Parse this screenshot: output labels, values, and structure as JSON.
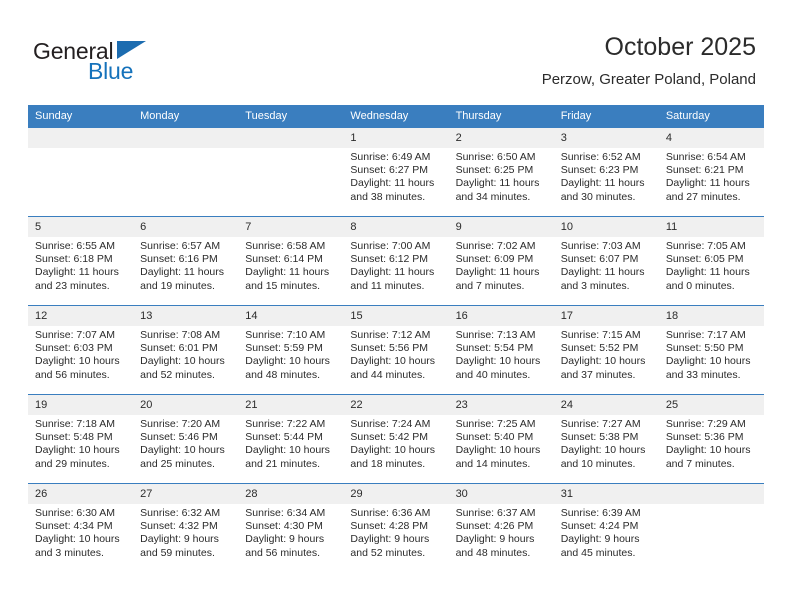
{
  "logo": {
    "word_top": "General",
    "word_bottom": "Blue",
    "triangle_color": "#1c6cb0",
    "blue_text_color": "#1572bb",
    "dark_text_color": "#231f20"
  },
  "header": {
    "title": "October 2025",
    "subtitle": "Perzow, Greater Poland, Poland"
  },
  "theme": {
    "header_blue": "#3a7ebf",
    "daynum_band": "#f0f0f0",
    "text": "#2b2b2b"
  },
  "weekday_headers": [
    "Sunday",
    "Monday",
    "Tuesday",
    "Wednesday",
    "Thursday",
    "Friday",
    "Saturday"
  ],
  "weeks": [
    [
      {
        "day": "",
        "empty": true,
        "sunrise": "",
        "sunset": "",
        "daylight_line1": "",
        "daylight_line2": ""
      },
      {
        "day": "",
        "empty": true,
        "sunrise": "",
        "sunset": "",
        "daylight_line1": "",
        "daylight_line2": ""
      },
      {
        "day": "",
        "empty": true,
        "sunrise": "",
        "sunset": "",
        "daylight_line1": "",
        "daylight_line2": ""
      },
      {
        "day": "1",
        "empty": false,
        "sunrise": "Sunrise: 6:49 AM",
        "sunset": "Sunset: 6:27 PM",
        "daylight_line1": "Daylight: 11 hours",
        "daylight_line2": "and 38 minutes."
      },
      {
        "day": "2",
        "empty": false,
        "sunrise": "Sunrise: 6:50 AM",
        "sunset": "Sunset: 6:25 PM",
        "daylight_line1": "Daylight: 11 hours",
        "daylight_line2": "and 34 minutes."
      },
      {
        "day": "3",
        "empty": false,
        "sunrise": "Sunrise: 6:52 AM",
        "sunset": "Sunset: 6:23 PM",
        "daylight_line1": "Daylight: 11 hours",
        "daylight_line2": "and 30 minutes."
      },
      {
        "day": "4",
        "empty": false,
        "sunrise": "Sunrise: 6:54 AM",
        "sunset": "Sunset: 6:21 PM",
        "daylight_line1": "Daylight: 11 hours",
        "daylight_line2": "and 27 minutes."
      }
    ],
    [
      {
        "day": "5",
        "empty": false,
        "sunrise": "Sunrise: 6:55 AM",
        "sunset": "Sunset: 6:18 PM",
        "daylight_line1": "Daylight: 11 hours",
        "daylight_line2": "and 23 minutes."
      },
      {
        "day": "6",
        "empty": false,
        "sunrise": "Sunrise: 6:57 AM",
        "sunset": "Sunset: 6:16 PM",
        "daylight_line1": "Daylight: 11 hours",
        "daylight_line2": "and 19 minutes."
      },
      {
        "day": "7",
        "empty": false,
        "sunrise": "Sunrise: 6:58 AM",
        "sunset": "Sunset: 6:14 PM",
        "daylight_line1": "Daylight: 11 hours",
        "daylight_line2": "and 15 minutes."
      },
      {
        "day": "8",
        "empty": false,
        "sunrise": "Sunrise: 7:00 AM",
        "sunset": "Sunset: 6:12 PM",
        "daylight_line1": "Daylight: 11 hours",
        "daylight_line2": "and 11 minutes."
      },
      {
        "day": "9",
        "empty": false,
        "sunrise": "Sunrise: 7:02 AM",
        "sunset": "Sunset: 6:09 PM",
        "daylight_line1": "Daylight: 11 hours",
        "daylight_line2": "and 7 minutes."
      },
      {
        "day": "10",
        "empty": false,
        "sunrise": "Sunrise: 7:03 AM",
        "sunset": "Sunset: 6:07 PM",
        "daylight_line1": "Daylight: 11 hours",
        "daylight_line2": "and 3 minutes."
      },
      {
        "day": "11",
        "empty": false,
        "sunrise": "Sunrise: 7:05 AM",
        "sunset": "Sunset: 6:05 PM",
        "daylight_line1": "Daylight: 11 hours",
        "daylight_line2": "and 0 minutes."
      }
    ],
    [
      {
        "day": "12",
        "empty": false,
        "sunrise": "Sunrise: 7:07 AM",
        "sunset": "Sunset: 6:03 PM",
        "daylight_line1": "Daylight: 10 hours",
        "daylight_line2": "and 56 minutes."
      },
      {
        "day": "13",
        "empty": false,
        "sunrise": "Sunrise: 7:08 AM",
        "sunset": "Sunset: 6:01 PM",
        "daylight_line1": "Daylight: 10 hours",
        "daylight_line2": "and 52 minutes."
      },
      {
        "day": "14",
        "empty": false,
        "sunrise": "Sunrise: 7:10 AM",
        "sunset": "Sunset: 5:59 PM",
        "daylight_line1": "Daylight: 10 hours",
        "daylight_line2": "and 48 minutes."
      },
      {
        "day": "15",
        "empty": false,
        "sunrise": "Sunrise: 7:12 AM",
        "sunset": "Sunset: 5:56 PM",
        "daylight_line1": "Daylight: 10 hours",
        "daylight_line2": "and 44 minutes."
      },
      {
        "day": "16",
        "empty": false,
        "sunrise": "Sunrise: 7:13 AM",
        "sunset": "Sunset: 5:54 PM",
        "daylight_line1": "Daylight: 10 hours",
        "daylight_line2": "and 40 minutes."
      },
      {
        "day": "17",
        "empty": false,
        "sunrise": "Sunrise: 7:15 AM",
        "sunset": "Sunset: 5:52 PM",
        "daylight_line1": "Daylight: 10 hours",
        "daylight_line2": "and 37 minutes."
      },
      {
        "day": "18",
        "empty": false,
        "sunrise": "Sunrise: 7:17 AM",
        "sunset": "Sunset: 5:50 PM",
        "daylight_line1": "Daylight: 10 hours",
        "daylight_line2": "and 33 minutes."
      }
    ],
    [
      {
        "day": "19",
        "empty": false,
        "sunrise": "Sunrise: 7:18 AM",
        "sunset": "Sunset: 5:48 PM",
        "daylight_line1": "Daylight: 10 hours",
        "daylight_line2": "and 29 minutes."
      },
      {
        "day": "20",
        "empty": false,
        "sunrise": "Sunrise: 7:20 AM",
        "sunset": "Sunset: 5:46 PM",
        "daylight_line1": "Daylight: 10 hours",
        "daylight_line2": "and 25 minutes."
      },
      {
        "day": "21",
        "empty": false,
        "sunrise": "Sunrise: 7:22 AM",
        "sunset": "Sunset: 5:44 PM",
        "daylight_line1": "Daylight: 10 hours",
        "daylight_line2": "and 21 minutes."
      },
      {
        "day": "22",
        "empty": false,
        "sunrise": "Sunrise: 7:24 AM",
        "sunset": "Sunset: 5:42 PM",
        "daylight_line1": "Daylight: 10 hours",
        "daylight_line2": "and 18 minutes."
      },
      {
        "day": "23",
        "empty": false,
        "sunrise": "Sunrise: 7:25 AM",
        "sunset": "Sunset: 5:40 PM",
        "daylight_line1": "Daylight: 10 hours",
        "daylight_line2": "and 14 minutes."
      },
      {
        "day": "24",
        "empty": false,
        "sunrise": "Sunrise: 7:27 AM",
        "sunset": "Sunset: 5:38 PM",
        "daylight_line1": "Daylight: 10 hours",
        "daylight_line2": "and 10 minutes."
      },
      {
        "day": "25",
        "empty": false,
        "sunrise": "Sunrise: 7:29 AM",
        "sunset": "Sunset: 5:36 PM",
        "daylight_line1": "Daylight: 10 hours",
        "daylight_line2": "and 7 minutes."
      }
    ],
    [
      {
        "day": "26",
        "empty": false,
        "sunrise": "Sunrise: 6:30 AM",
        "sunset": "Sunset: 4:34 PM",
        "daylight_line1": "Daylight: 10 hours",
        "daylight_line2": "and 3 minutes."
      },
      {
        "day": "27",
        "empty": false,
        "sunrise": "Sunrise: 6:32 AM",
        "sunset": "Sunset: 4:32 PM",
        "daylight_line1": "Daylight: 9 hours",
        "daylight_line2": "and 59 minutes."
      },
      {
        "day": "28",
        "empty": false,
        "sunrise": "Sunrise: 6:34 AM",
        "sunset": "Sunset: 4:30 PM",
        "daylight_line1": "Daylight: 9 hours",
        "daylight_line2": "and 56 minutes."
      },
      {
        "day": "29",
        "empty": false,
        "sunrise": "Sunrise: 6:36 AM",
        "sunset": "Sunset: 4:28 PM",
        "daylight_line1": "Daylight: 9 hours",
        "daylight_line2": "and 52 minutes."
      },
      {
        "day": "30",
        "empty": false,
        "sunrise": "Sunrise: 6:37 AM",
        "sunset": "Sunset: 4:26 PM",
        "daylight_line1": "Daylight: 9 hours",
        "daylight_line2": "and 48 minutes."
      },
      {
        "day": "31",
        "empty": false,
        "sunrise": "Sunrise: 6:39 AM",
        "sunset": "Sunset: 4:24 PM",
        "daylight_line1": "Daylight: 9 hours",
        "daylight_line2": "and 45 minutes."
      },
      {
        "day": "",
        "empty": true,
        "sunrise": "",
        "sunset": "",
        "daylight_line1": "",
        "daylight_line2": ""
      }
    ]
  ]
}
